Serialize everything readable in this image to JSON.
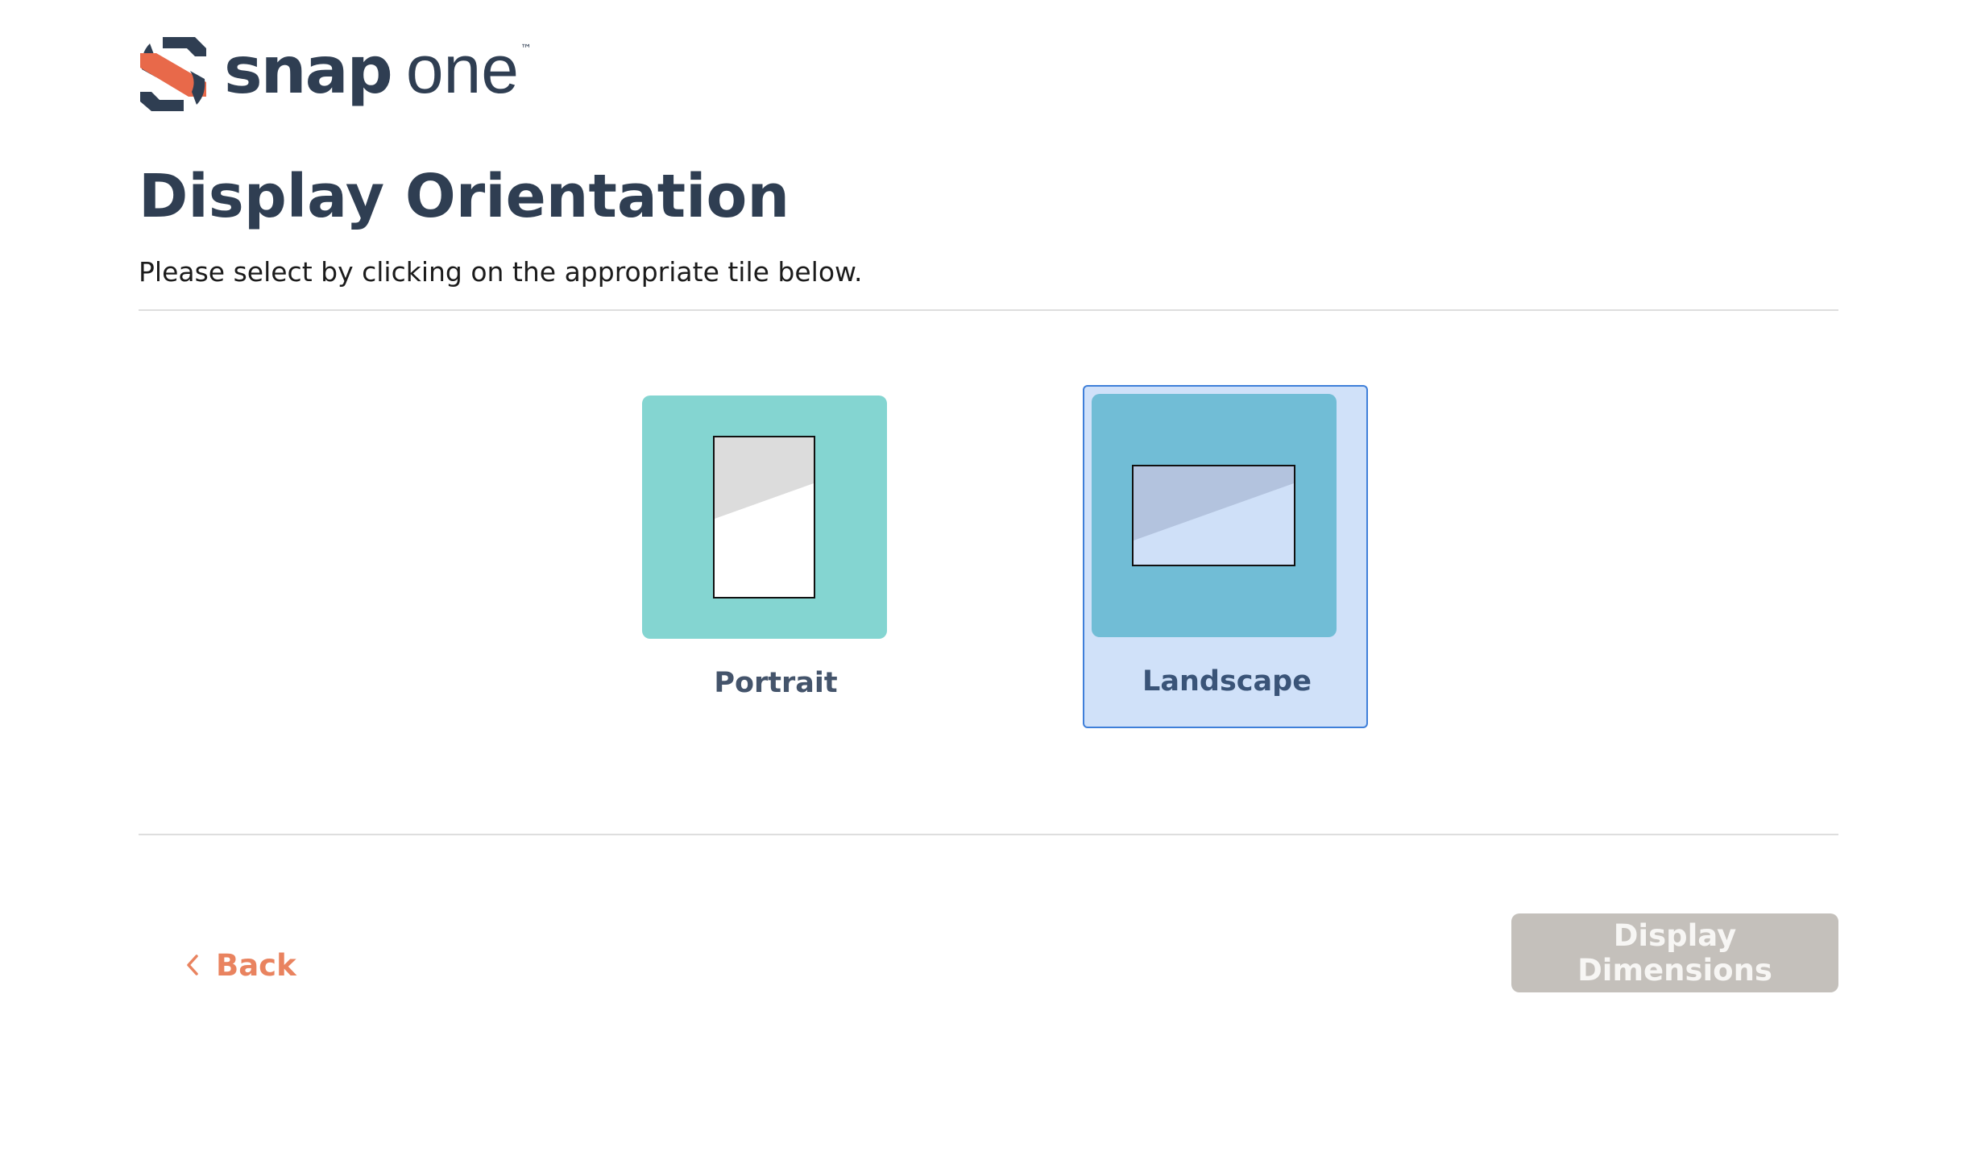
{
  "brand": {
    "name_bold": "snap",
    "name_light": "one",
    "trademark": "™",
    "colors": {
      "mark_orange": "#e8694a",
      "mark_navy": "#2f3e52"
    }
  },
  "header": {
    "title": "Display Orientation",
    "instructions": "Please select by clicking on the appropriate tile below."
  },
  "tiles": [
    {
      "label": "Portrait",
      "icon": "portrait-screen-icon",
      "selected": false,
      "color": "#84d5d1"
    },
    {
      "label": "Landscape",
      "icon": "landscape-screen-icon",
      "selected": true,
      "color": "#71bdd6"
    }
  ],
  "footer": {
    "back_label": "Back",
    "back_icon": "chevron-left-icon",
    "next_label": "Display Dimensions",
    "next_disabled": true
  },
  "colors": {
    "accent": "#e9835f",
    "selected_tile_bg": "#d0e1f9",
    "selected_tile_border": "#3f7fd9",
    "disabled_button": "#c4c0bb"
  }
}
